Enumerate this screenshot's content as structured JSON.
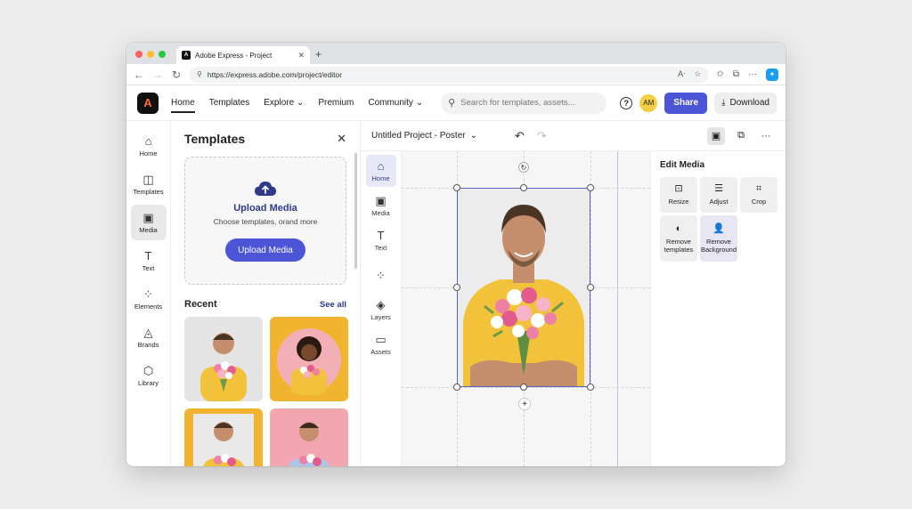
{
  "browser": {
    "tab_title": "Adobe Express - Project",
    "tab_favicon": "A",
    "new_tab": "+",
    "url": "https://express.adobe.com/project/editor"
  },
  "header": {
    "logo": "A",
    "nav": [
      {
        "label": "Home",
        "active": true
      },
      {
        "label": "Templates"
      },
      {
        "label": "Explore ⌄"
      },
      {
        "label": "Premium"
      },
      {
        "label": "Community ⌄"
      }
    ],
    "search_placeholder": "Search for templates, assets...",
    "help": "?",
    "avatar_initials": "AM",
    "share_label": "Share",
    "download_label": "Download"
  },
  "left_rail": [
    {
      "label": "Home",
      "icon": "home-icon",
      "glyph": "⌂"
    },
    {
      "label": "Templates",
      "icon": "templates-icon",
      "glyph": "◫"
    },
    {
      "label": "Media",
      "icon": "media-icon",
      "glyph": "▣",
      "active": true
    },
    {
      "label": "Text",
      "icon": "text-icon",
      "glyph": "T"
    },
    {
      "label": "Elements",
      "icon": "elements-icon",
      "glyph": "⁘"
    },
    {
      "label": "Brands",
      "icon": "brands-icon",
      "glyph": "◬"
    },
    {
      "label": "Library",
      "icon": "library-icon",
      "glyph": "⬡"
    }
  ],
  "templates_panel": {
    "title": "Templates",
    "close": "✕",
    "upload_title": "Upload Media",
    "upload_subtitle": "Choose templates, orand more",
    "upload_button": "Upload Media",
    "recent_title": "Recent",
    "see_all": "See all"
  },
  "inner_rail": [
    {
      "label": "Home",
      "icon": "home-icon",
      "glyph": "⌂",
      "active": true
    },
    {
      "label": "Media",
      "icon": "media-icon",
      "glyph": "▣"
    },
    {
      "label": "Text",
      "icon": "text-icon",
      "glyph": "T"
    },
    {
      "label": "",
      "icon": "elements-icon",
      "glyph": "⁘"
    },
    {
      "label": "Layers",
      "icon": "layers-icon",
      "glyph": "◈"
    },
    {
      "label": "Assets",
      "icon": "assets-icon",
      "glyph": "▭"
    }
  ],
  "canvas_toolbar": {
    "project_name": "Untitled Project - Poster",
    "caret": "⌄",
    "undo": "↶",
    "redo": "↷",
    "more": "···"
  },
  "canvas": {
    "rotate": "↻",
    "add": "+"
  },
  "edit_media": {
    "title": "Edit Media",
    "tools": [
      {
        "label": "Resize",
        "icon": "resize-icon",
        "glyph": "⊡"
      },
      {
        "label": "Adjust",
        "icon": "adjust-icon",
        "glyph": "☰"
      },
      {
        "label": "Crop",
        "icon": "crop-icon",
        "glyph": "⌗"
      },
      {
        "label": "Remove templates",
        "icon": "remove-templates-icon",
        "glyph": "◐"
      },
      {
        "label": "Remove Background",
        "icon": "remove-background-icon",
        "glyph": "👤",
        "selected": true
      }
    ]
  },
  "colors": {
    "accent": "#4b55d6",
    "link": "#2d3a8c",
    "avatar": "#f3cf47",
    "shirt": "#f2c23a"
  }
}
